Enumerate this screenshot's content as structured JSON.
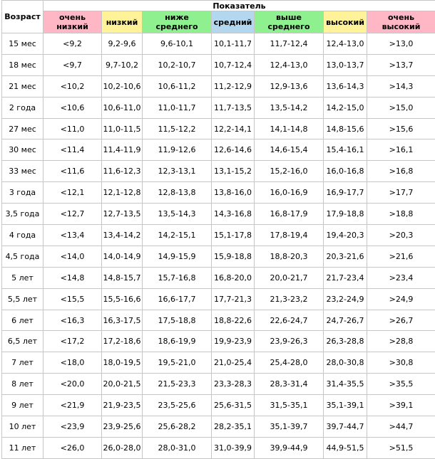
{
  "table": {
    "age_header": "Возраст",
    "group_header": "Показатель",
    "bands": [
      {
        "label": "очень низкий",
        "color": "#ffb7c6"
      },
      {
        "label": "низкий",
        "color": "#fff299"
      },
      {
        "label": "ниже среднего",
        "color": "#8ff08f"
      },
      {
        "label": "средний",
        "color": "#b3d7ef"
      },
      {
        "label": "выше среднего",
        "color": "#8ff08f"
      },
      {
        "label": "высокий",
        "color": "#fff299"
      },
      {
        "label": "очень высокий",
        "color": "#ffb7c6"
      }
    ],
    "rows": [
      {
        "age": "15 мес",
        "values": [
          "<9,2",
          "9,2-9,6",
          "9,6-10,1",
          "10,1-11,7",
          "11,7-12,4",
          "12,4-13,0",
          ">13,0"
        ]
      },
      {
        "age": "18 мес",
        "values": [
          "<9,7",
          "9,7-10,2",
          "10,2-10,7",
          "10,7-12,4",
          "12,4-13,0",
          "13,0-13,7",
          ">13,7"
        ]
      },
      {
        "age": "21 мес",
        "values": [
          "<10,2",
          "10,2-10,6",
          "10,6-11,2",
          "11,2-12,9",
          "12,9-13,6",
          "13,6-14,3",
          ">14,3"
        ]
      },
      {
        "age": "2 года",
        "values": [
          "<10,6",
          "10,6-11,0",
          "11,0-11,7",
          "11,7-13,5",
          "13,5-14,2",
          "14,2-15,0",
          ">15,0"
        ]
      },
      {
        "age": "27 мес",
        "values": [
          "<11,0",
          "11,0-11,5",
          "11,5-12,2",
          "12,2-14,1",
          "14,1-14,8",
          "14,8-15,6",
          ">15,6"
        ]
      },
      {
        "age": "30 мес",
        "values": [
          "<11,4",
          "11,4-11,9",
          "11,9-12,6",
          "12,6-14,6",
          "14,6-15,4",
          "15,4-16,1",
          ">16,1"
        ]
      },
      {
        "age": "33 мес",
        "values": [
          "<11,6",
          "11,6-12,3",
          "12,3-13,1",
          "13,1-15,2",
          "15,2-16,0",
          "16,0-16,8",
          ">16,8"
        ]
      },
      {
        "age": "3 года",
        "values": [
          "<12,1",
          "12,1-12,8",
          "12,8-13,8",
          "13,8-16,0",
          "16,0-16,9",
          "16,9-17,7",
          ">17,7"
        ]
      },
      {
        "age": "3,5 года",
        "values": [
          "<12,7",
          "12,7-13,5",
          "13,5-14,3",
          "14,3-16,8",
          "16,8-17,9",
          "17,9-18,8",
          ">18,8"
        ]
      },
      {
        "age": "4 года",
        "values": [
          "<13,4",
          "13,4-14,2",
          "14,2-15,1",
          "15,1-17,8",
          "17,8-19,4",
          "19,4-20,3",
          ">20,3"
        ]
      },
      {
        "age": "4,5 года",
        "values": [
          "<14,0",
          "14,0-14,9",
          "14,9-15,9",
          "15,9-18,8",
          "18,8-20,3",
          "20,3-21,6",
          ">21,6"
        ]
      },
      {
        "age": "5 лет",
        "values": [
          "<14,8",
          "14,8-15,7",
          "15,7-16,8",
          "16,8-20,0",
          "20,0-21,7",
          "21,7-23,4",
          ">23,4"
        ]
      },
      {
        "age": "5,5 лет",
        "values": [
          "<15,5",
          "15,5-16,6",
          "16,6-17,7",
          "17,7-21,3",
          "21,3-23,2",
          "23,2-24,9",
          ">24,9"
        ]
      },
      {
        "age": "6 лет",
        "values": [
          "<16,3",
          "16,3-17,5",
          "17,5-18,8",
          "18,8-22,6",
          "22,6-24,7",
          "24,7-26,7",
          ">26,7"
        ]
      },
      {
        "age": "6,5 лет",
        "values": [
          "<17,2",
          "17,2-18,6",
          "18,6-19,9",
          "19,9-23,9",
          "23,9-26,3",
          "26,3-28,8",
          ">28,8"
        ]
      },
      {
        "age": "7 лет",
        "values": [
          "<18,0",
          "18,0-19,5",
          "19,5-21,0",
          "21,0-25,4",
          "25,4-28,0",
          "28,0-30,8",
          ">30,8"
        ]
      },
      {
        "age": "8 лет",
        "values": [
          "<20,0",
          "20,0-21,5",
          "21,5-23,3",
          "23,3-28,3",
          "28,3-31,4",
          "31,4-35,5",
          ">35,5"
        ]
      },
      {
        "age": "9 лет",
        "values": [
          "<21,9",
          "21,9-23,5",
          "23,5-25,6",
          "25,6-31,5",
          "31,5-35,1",
          "35,1-39,1",
          ">39,1"
        ]
      },
      {
        "age": "10 лет",
        "values": [
          "<23,9",
          "23,9-25,6",
          "25,6-28,2",
          "28,2-35,1",
          "35,1-39,7",
          "39,7-44,7",
          ">44,7"
        ]
      },
      {
        "age": "11 лет",
        "values": [
          "<26,0",
          "26,0-28,0",
          "28,0-31,0",
          "31,0-39,9",
          "39,9-44,9",
          "44,9-51,5",
          ">51,5"
        ]
      }
    ]
  }
}
